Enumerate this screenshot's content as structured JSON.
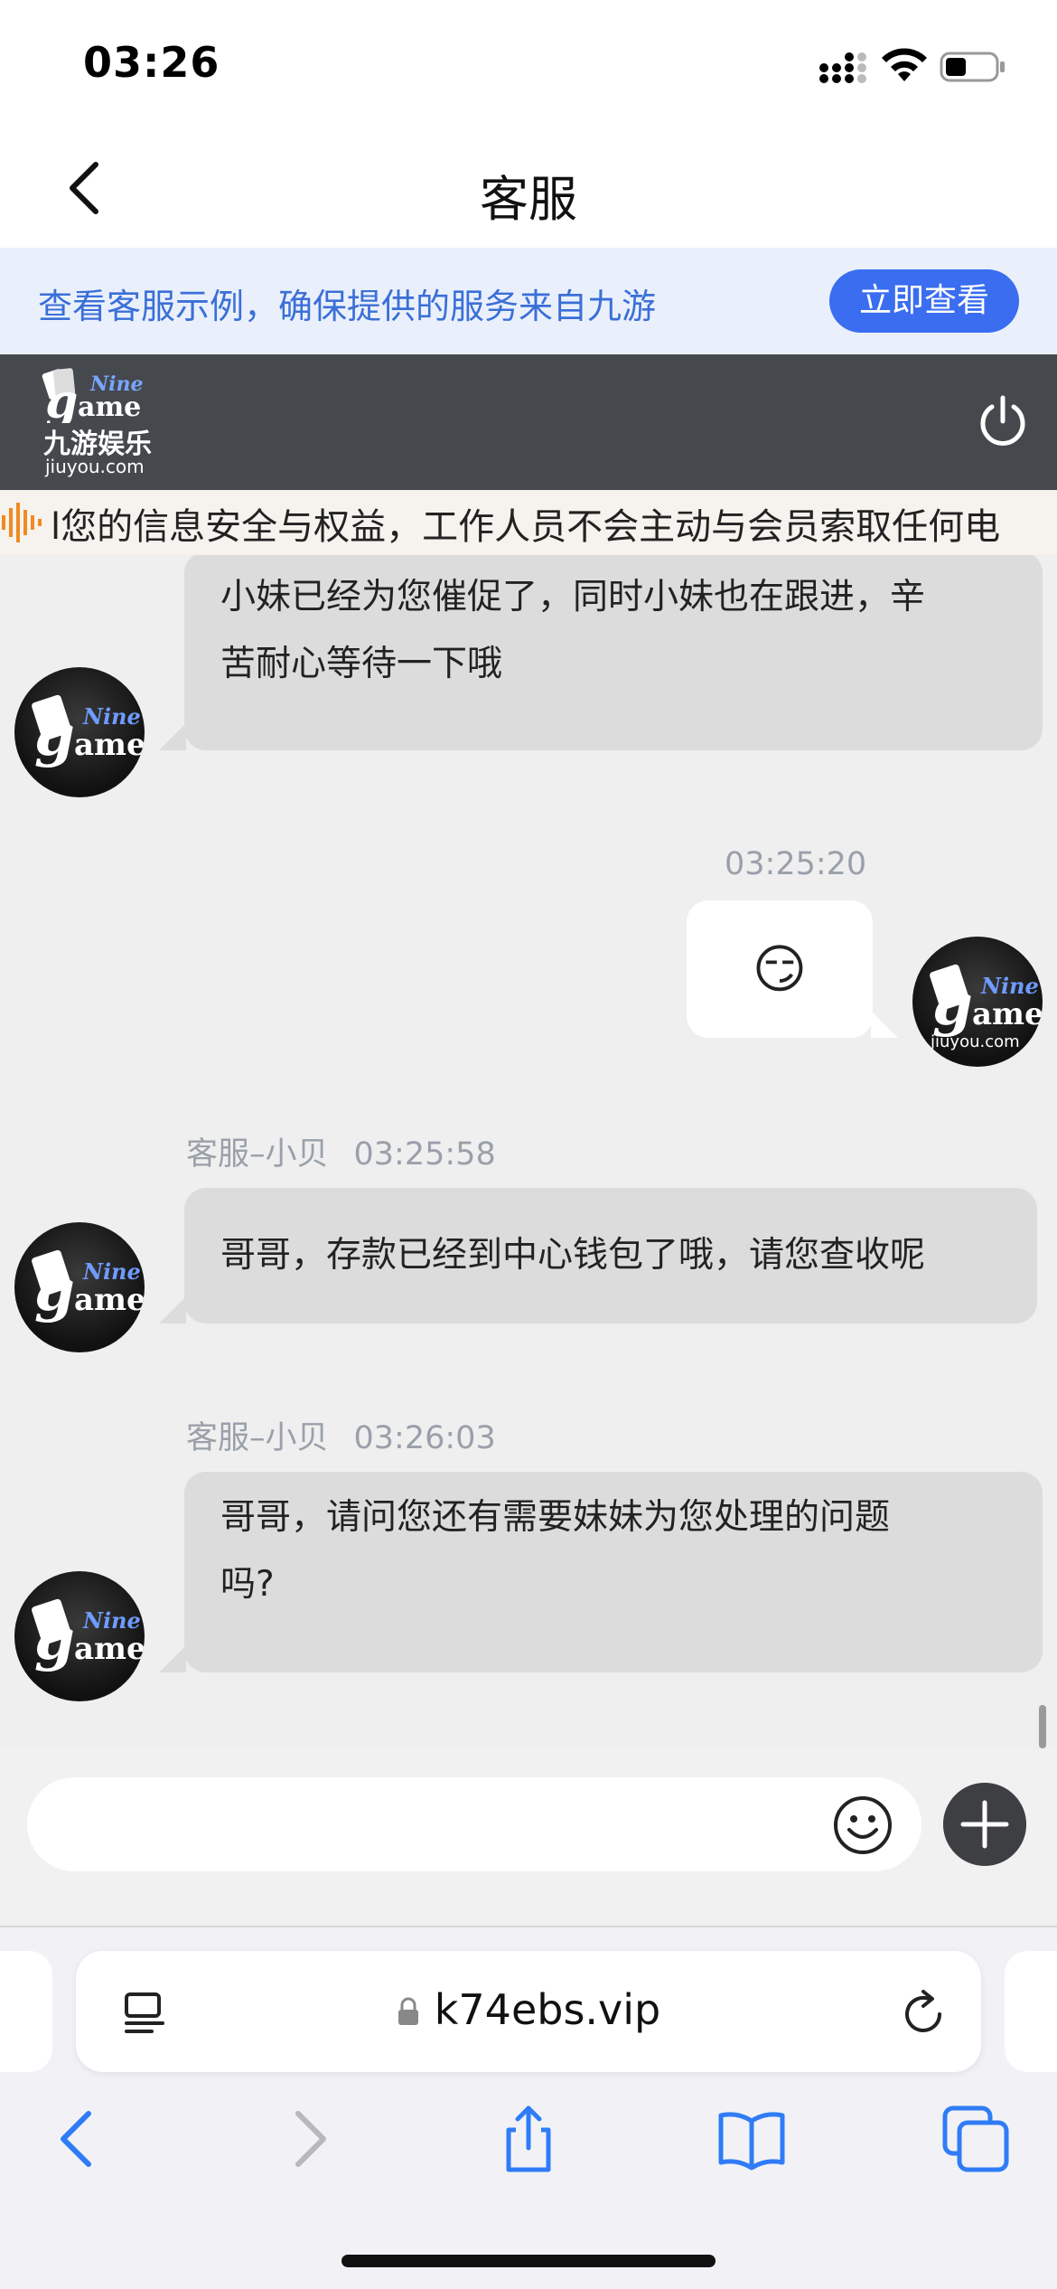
{
  "status_bar": {
    "time": "03:26"
  },
  "nav": {
    "title": "客服"
  },
  "notice": {
    "text": "查看客服示例，确保提供的服务来自九游",
    "button_label": "立即查看"
  },
  "brand": {
    "logo_nine": "Nine",
    "logo_g": "g",
    "logo_ame": "ame",
    "logo_cn": "九游娱乐",
    "logo_domain": "jiuyou.com"
  },
  "marquee": {
    "text": "l您的信息安全与权益，工作人员不会主动与会员索取任何电"
  },
  "messages": [
    {
      "side": "agent",
      "text_line1": "小妹已经为您催促了，同时小妹也在跟进，辛",
      "text_line2": "苦耐心等待一下哦"
    },
    {
      "side": "user",
      "timestamp": "03:25:20",
      "emoji": "😏"
    },
    {
      "side": "agent",
      "sender": "客服–小贝",
      "timestamp": "03:25:58",
      "text": "哥哥，存款已经到中心钱包了哦，请您查收呢"
    },
    {
      "side": "agent",
      "sender": "客服–小贝",
      "timestamp": "03:26:03",
      "text_line1": "哥哥，请问您还有需要妹妹为您处理的问题",
      "text_line2": "吗?"
    }
  ],
  "input": {
    "value": "",
    "placeholder": ""
  },
  "safari": {
    "url": "k74ebs.vip"
  },
  "avatar": {
    "nine": "Nine",
    "g": "g",
    "ame": "ame",
    "domain": "jiuyou.com"
  },
  "colors": {
    "accent": "#3a6df0",
    "notice_bg": "#eaf0fb",
    "brand_bg": "#45494e",
    "chat_bg": "#efefef",
    "agent_bubble": "#dcdcdc",
    "user_bubble": "#ffffff",
    "ios_blue": "#2f7cf6"
  }
}
